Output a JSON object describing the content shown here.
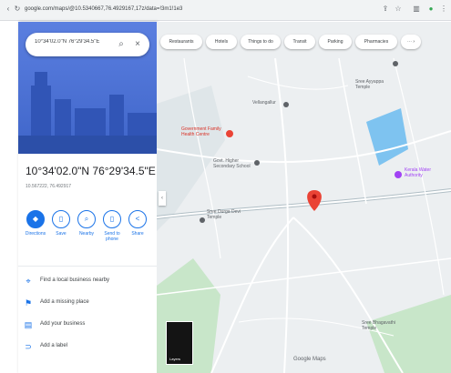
{
  "browser": {
    "url": "google.com/maps/@10.5340667,76.4929167,17z/data=!3m1!1e3",
    "icons": [
      "back-icon",
      "reload-icon",
      "site-info-icon",
      "share-icon",
      "star-icon",
      "extensions-icon",
      "profile-icon",
      "menu-icon"
    ]
  },
  "search": {
    "query": "10°34'02.0\"N 76°29'34.5\"E",
    "search_icon": "⌕",
    "close_icon": "×"
  },
  "place": {
    "coordinates": "10°34'02.0\"N 76°29'34.5\"E",
    "decimal": "10.567222, 76.492917"
  },
  "actions": [
    {
      "label": "Directions",
      "icon": "◆"
    },
    {
      "label": "Save",
      "icon": "▯"
    },
    {
      "label": "Nearby",
      "icon": "⌕"
    },
    {
      "label": "Send to phone",
      "icon": "▯"
    },
    {
      "label": "Share",
      "icon": "<"
    }
  ],
  "info_rows": [
    {
      "text": "Find a local business nearby",
      "icon": "⌖"
    },
    {
      "text": "Add a missing place",
      "icon": "⚑"
    },
    {
      "text": "Add your business",
      "icon": "▤"
    },
    {
      "text": "Add a label",
      "icon": "⊃"
    }
  ],
  "chips": [
    "Restaurants",
    "Hotels",
    "Things to do",
    "Transit",
    "Parking",
    "Pharmacies"
  ],
  "chip_more": "⋯ ›",
  "map_labels": {
    "government": "Government Family Health Centre",
    "school": "Govt. Higher Secondary School",
    "temple": "Sree Ayyappa Temple",
    "temple_left": "Sree Durga Devi Temple",
    "temple_bottom": "Sree Bhagavathi Temple",
    "purple": "Kerala Water Authority",
    "mid": "Vellangallur",
    "google": "Google Maps",
    "layers": "Layers"
  },
  "colors": {
    "panel_hero": "#4f74d8",
    "accent": "#1a73e8",
    "map_water": "#7ec3f0",
    "map_green": "#c8e6c9",
    "pin": "#ea4335"
  }
}
